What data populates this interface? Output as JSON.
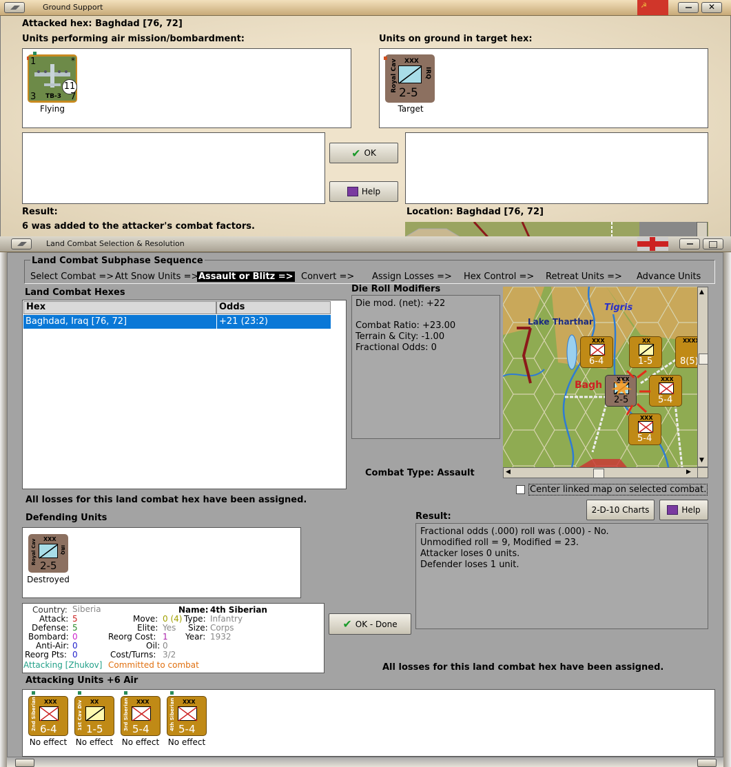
{
  "ground_support": {
    "title": "Ground Support",
    "attacked_hex": "Attacked hex: Baghdad  [76, 72]",
    "air_units_heading": "Units performing air mission/bombardment:",
    "ground_units_heading": "Units on ground in target hex:",
    "air_unit": {
      "name": "TB-3",
      "top_left": "1",
      "top_right": "*",
      "bottom_left": "3",
      "bottom_right": "7",
      "circle": "11",
      "status": "Flying"
    },
    "target_unit": {
      "size": "XXX",
      "name": "Royal Cav",
      "nation": "IRQ",
      "strength": "2-5",
      "status": "Target"
    },
    "ok_label": "OK",
    "help_label": "Help",
    "result_label": "Result:",
    "result_text": "6 was added to the attacker's combat factors.",
    "location_label": "Location:  Baghdad  [76, 72]"
  },
  "land_combat": {
    "title": "Land Combat Selection & Resolution",
    "subphase_title": "Land Combat Subphase Sequence",
    "sequence": [
      "Select Combat =>",
      "Att Snow Units =>",
      "Assault or Blitz =>",
      "Convert =>",
      "Assign Losses =>",
      "Hex Control =>",
      "Retreat Units =>",
      "Advance Units"
    ],
    "hexes_title": "Land Combat Hexes",
    "hex_columns": [
      "Hex",
      "Odds"
    ],
    "hex_rows": [
      {
        "hex": "Baghdad, Iraq [76, 72]",
        "odds": "+21 (23:2)"
      }
    ],
    "die_roll_title": "Die Roll Modifiers",
    "die_roll_lines": [
      "Die mod. (net): +22",
      "",
      "Combat Ratio: +23.00",
      "Terrain & City: -1.00",
      "Fractional Odds: 0"
    ],
    "combat_type": "Combat Type:  Assault",
    "losses_assigned_left": "All losses for this land combat hex have been assigned.",
    "center_map_label": "Center linked map on selected combat.",
    "charts_label": "2-D-10 Charts",
    "help_label": "Help",
    "defending_title": "Defending Units",
    "defender": {
      "size": "XXX",
      "name": "Royal Cav",
      "nation": "IRQ",
      "strength": "2-5",
      "status": "Destroyed"
    },
    "result_label": "Result:",
    "result_lines": [
      "Fractional odds (.000) roll was (.000)  - No.",
      "Unmodified roll = 9, Modified = 23.",
      "Attacker loses 0 units.",
      "Defender loses 1 unit."
    ],
    "unit_info": {
      "country_label": "Country:",
      "country": "Siberia",
      "attack_label": "Attack:",
      "attack": "5",
      "defense_label": "Defense:",
      "defense": "5",
      "bombard_label": "Bombard:",
      "bombard": "0",
      "antiair_label": "Anti-Air:",
      "antiair": "0",
      "reorg_label": "Reorg Pts:",
      "reorg": "0",
      "name_label": "Name:",
      "name": "4th Siberian",
      "move_label": "Move:",
      "move": "0 (4)",
      "type_label": "Type:",
      "type": "Infantry",
      "elite_label": "Elite:",
      "elite": "Yes",
      "size_label": "Size:",
      "size": "Corps",
      "reorg_cost_label": "Reorg Cost:",
      "reorg_cost": "1",
      "year_label": "Year:",
      "year": "1932",
      "oil_label": "Oil:",
      "oil": "0",
      "cost_label": "Cost/Turns:",
      "cost": "3/2",
      "attacking": "Attacking [Zhukov]",
      "committed": "Committed to combat"
    },
    "ok_done_label": "OK - Done",
    "losses_assigned_right": "All losses for this land combat hex have been assigned.",
    "attacking_title": "Attacking Units +6 Air",
    "attackers": [
      {
        "size": "XXX",
        "name": "2nd Siberian",
        "strength": "6-4",
        "status": "No effect",
        "kind": "inf"
      },
      {
        "size": "XX",
        "name": "1st Cav Div",
        "strength": "1-5",
        "status": "No effect",
        "kind": "cav"
      },
      {
        "size": "XXX",
        "name": "3rd Siberian",
        "strength": "5-4",
        "status": "No effect",
        "kind": "inf"
      },
      {
        "size": "XXX",
        "name": "4th Siberian",
        "strength": "5-4",
        "status": "No effect",
        "kind": "inf"
      }
    ],
    "map": {
      "labels": [
        "Tigris",
        "Lake Tharthar",
        "Bagh"
      ],
      "units": [
        {
          "size": "XXX",
          "name": "2nd Siberian",
          "strength": "6-4"
        },
        {
          "size": "XX",
          "name": "1st Cav Div",
          "strength": "1-5"
        },
        {
          "size": "XXXX",
          "name": "Zhukov",
          "strength": "8(5)"
        },
        {
          "size": "XXX",
          "name": "3rd Siberian",
          "strength": "5-4"
        },
        {
          "size": "XXX",
          "name": "4th Siberian",
          "strength": "5-4"
        },
        {
          "size": "XXX",
          "name": "Royal Cav",
          "strength": "2-5"
        }
      ]
    },
    "colors": {
      "attacker": "#c08a16",
      "defender": "#8c7060",
      "selection": "#0a78d7",
      "red_text": "#cc2222",
      "blue_text": "#2222cc"
    }
  }
}
